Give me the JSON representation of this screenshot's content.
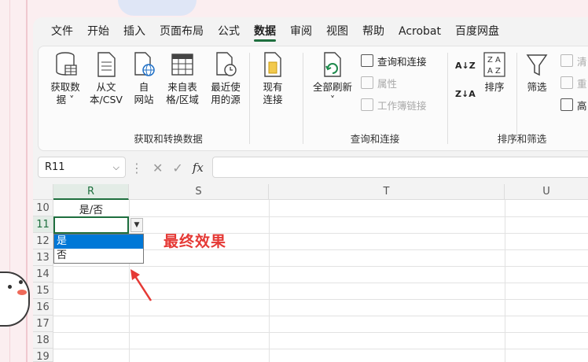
{
  "menu": [
    "文件",
    "开始",
    "插入",
    "页面布局",
    "公式",
    "数据",
    "审阅",
    "视图",
    "帮助",
    "Acrobat",
    "百度网盘"
  ],
  "active_menu": "数据",
  "ribbon": {
    "get_transform": {
      "label": "获取和转换数据",
      "buttons": [
        {
          "l1": "获取数",
          "l2": "据 ˅"
        },
        {
          "l1": "从文",
          "l2": "本/CSV"
        },
        {
          "l1": "自",
          "l2": "网站"
        },
        {
          "l1": "来自表",
          "l2": "格/区域"
        },
        {
          "l1": "最近使",
          "l2": "用的源"
        },
        {
          "l1": "现有",
          "l2": "连接"
        }
      ]
    },
    "query": {
      "label": "查询和连接",
      "refresh_l1": "全部刷新",
      "refresh_l2": "˅",
      "items": [
        "查询和连接",
        "属性",
        "工作簿链接"
      ]
    },
    "sort_filter": {
      "label": "排序和筛选",
      "sort": "排序",
      "filter": "筛选",
      "az": "A↓Z",
      "za": "Z↓A",
      "clear": "清",
      "reapply": "重",
      "advanced": "高"
    }
  },
  "formula_bar": {
    "name_box": "R11",
    "chevron": "⌵",
    "dots": "⋮",
    "cancel": "✕",
    "confirm": "✓",
    "fx": "fx",
    "value": ""
  },
  "grid": {
    "columns": [
      "R",
      "S",
      "T",
      "U"
    ],
    "rows": [
      "10",
      "11",
      "12",
      "13",
      "14",
      "15",
      "16",
      "17",
      "18",
      "19"
    ],
    "header_cell": "是/否",
    "dropdown_options": [
      "是",
      "否"
    ],
    "dropdown_arrow": "▼"
  },
  "annotation": "最终效果"
}
